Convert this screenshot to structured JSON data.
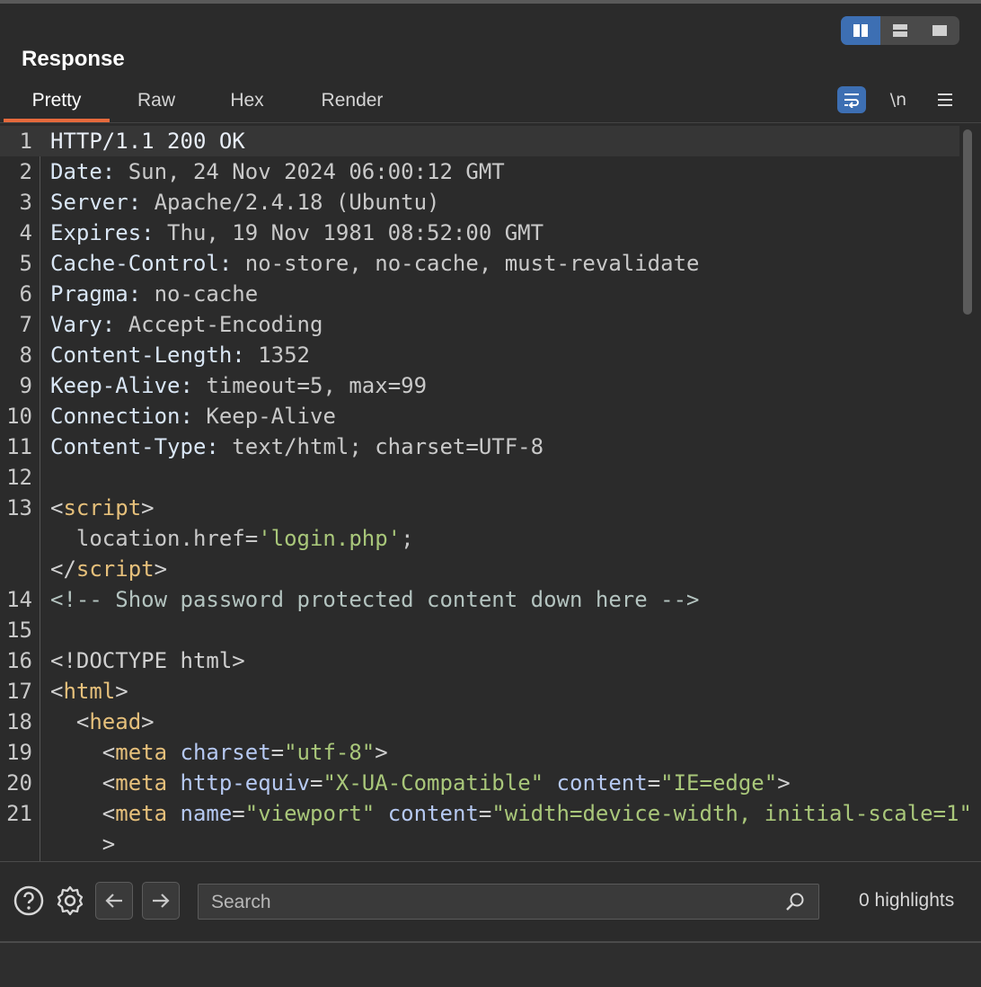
{
  "panel": {
    "title": "Response"
  },
  "tabs": [
    {
      "label": "Pretty",
      "active": true
    },
    {
      "label": "Raw",
      "active": false
    },
    {
      "label": "Hex",
      "active": false
    },
    {
      "label": "Render",
      "active": false
    }
  ],
  "layout_toggle": {
    "icons": [
      "split-vertical-icon",
      "split-horizontal-icon",
      "single-pane-icon"
    ],
    "active": 0
  },
  "toolbar": {
    "wrap_icon": "word-wrap-icon",
    "newline_label": "\\n",
    "menu_icon": "hamburger-menu-icon"
  },
  "lines": [
    {
      "n": "1",
      "segs": [
        [
          "first",
          "HTTP/1.1 200 OK"
        ]
      ]
    },
    {
      "n": "2",
      "segs": [
        [
          "key",
          "Date:"
        ],
        [
          "val",
          " Sun, 24 Nov 2024 06:00:12 GMT"
        ]
      ]
    },
    {
      "n": "3",
      "segs": [
        [
          "key",
          "Server:"
        ],
        [
          "val",
          " Apache/2.4.18 (Ubuntu)"
        ]
      ]
    },
    {
      "n": "4",
      "segs": [
        [
          "key",
          "Expires:"
        ],
        [
          "val",
          " Thu, 19 Nov 1981 08:52:00 GMT"
        ]
      ]
    },
    {
      "n": "5",
      "segs": [
        [
          "key",
          "Cache-Control:"
        ],
        [
          "val",
          " no-store, no-cache, must-revalidate"
        ]
      ]
    },
    {
      "n": "6",
      "segs": [
        [
          "key",
          "Pragma:"
        ],
        [
          "val",
          " no-cache"
        ]
      ]
    },
    {
      "n": "7",
      "segs": [
        [
          "key",
          "Vary:"
        ],
        [
          "val",
          " Accept-Encoding"
        ]
      ]
    },
    {
      "n": "8",
      "segs": [
        [
          "key",
          "Content-Length:"
        ],
        [
          "val",
          " 1352"
        ]
      ]
    },
    {
      "n": "9",
      "segs": [
        [
          "key",
          "Keep-Alive:"
        ],
        [
          "val",
          " timeout=5, max=99"
        ]
      ]
    },
    {
      "n": "10",
      "segs": [
        [
          "key",
          "Connection:"
        ],
        [
          "val",
          " Keep-Alive"
        ]
      ]
    },
    {
      "n": "11",
      "segs": [
        [
          "key",
          "Content-Type:"
        ],
        [
          "val",
          " text/html; charset=UTF-8"
        ]
      ]
    },
    {
      "n": "12",
      "segs": []
    },
    {
      "n": "13",
      "segs": [
        [
          "punct",
          "<"
        ],
        [
          "tag",
          "script"
        ],
        [
          "punct",
          ">"
        ]
      ]
    },
    {
      "n": "",
      "segs": [
        [
          "val",
          "  location.href="
        ],
        [
          "str",
          "'login.php'"
        ],
        [
          "val",
          ";"
        ]
      ]
    },
    {
      "n": "",
      "segs": [
        [
          "punct",
          "</"
        ],
        [
          "tag",
          "script"
        ],
        [
          "punct",
          ">"
        ]
      ]
    },
    {
      "n": "14",
      "segs": [
        [
          "comment",
          "<!-- Show password protected content down here -->"
        ]
      ]
    },
    {
      "n": "15",
      "segs": []
    },
    {
      "n": "16",
      "segs": [
        [
          "punct",
          "<!DOCTYPE html>"
        ]
      ]
    },
    {
      "n": "17",
      "segs": [
        [
          "punct",
          "<"
        ],
        [
          "tag",
          "html"
        ],
        [
          "punct",
          ">"
        ]
      ]
    },
    {
      "n": "18",
      "segs": [
        [
          "punct",
          "  <"
        ],
        [
          "tag",
          "head"
        ],
        [
          "punct",
          ">"
        ]
      ]
    },
    {
      "n": "19",
      "segs": [
        [
          "punct",
          "    <"
        ],
        [
          "tag",
          "meta"
        ],
        [
          "punct",
          " "
        ],
        [
          "attr",
          "charset"
        ],
        [
          "punct",
          "="
        ],
        [
          "str",
          "\"utf-8\""
        ],
        [
          "punct",
          ">"
        ]
      ]
    },
    {
      "n": "20",
      "segs": [
        [
          "punct",
          "    <"
        ],
        [
          "tag",
          "meta"
        ],
        [
          "punct",
          " "
        ],
        [
          "attr",
          "http-equiv"
        ],
        [
          "punct",
          "="
        ],
        [
          "str",
          "\"X-UA-Compatible\""
        ],
        [
          "punct",
          " "
        ],
        [
          "attr",
          "content"
        ],
        [
          "punct",
          "="
        ],
        [
          "str",
          "\"IE=edge\""
        ],
        [
          "punct",
          ">"
        ]
      ]
    },
    {
      "n": "21",
      "segs": [
        [
          "punct",
          "    <"
        ],
        [
          "tag",
          "meta"
        ],
        [
          "punct",
          " "
        ],
        [
          "attr",
          "name"
        ],
        [
          "punct",
          "="
        ],
        [
          "str",
          "\"viewport\""
        ],
        [
          "punct",
          " "
        ],
        [
          "attr",
          "content"
        ],
        [
          "punct",
          "="
        ],
        [
          "str",
          "\"width=device-width, initial-scale=1\""
        ]
      ]
    },
    {
      "n": "",
      "segs": [
        [
          "punct",
          "    >"
        ]
      ]
    }
  ],
  "bottom": {
    "help_icon": "help-icon",
    "settings_icon": "gear-icon",
    "back_icon": "arrow-left-icon",
    "forward_icon": "arrow-right-icon",
    "search_placeholder": "Search",
    "search_value": "",
    "highlights": "0 highlights"
  }
}
